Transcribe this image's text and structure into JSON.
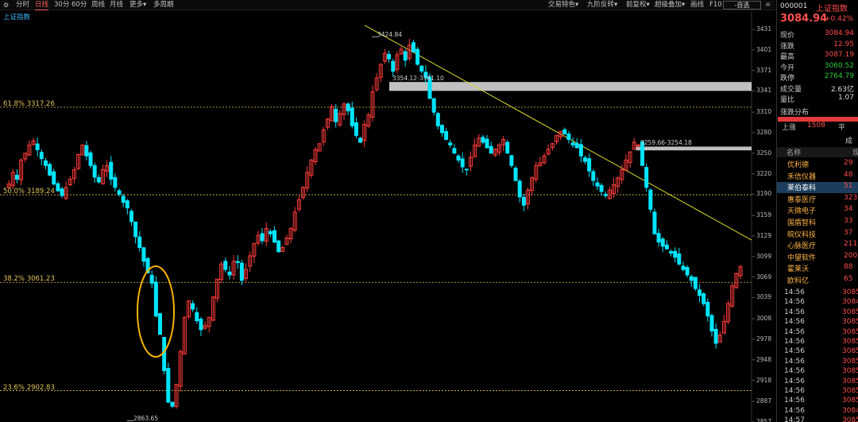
{
  "toolbar": {
    "periods": [
      "分时",
      "日线",
      "30分",
      "60分",
      "周线",
      "月线"
    ],
    "active_period": "日线",
    "more": "更多",
    "multi_period": "多周期",
    "right_items": [
      "交易特色",
      "九阶反转",
      "前复权",
      "超级叠加",
      "画线",
      "F10"
    ],
    "self_select": "-自选"
  },
  "chart": {
    "index_label": "上证指数",
    "y_ticks": [
      "3431",
      "3401",
      "3371",
      "3341",
      "3310",
      "3280",
      "3250",
      "3220",
      "3190",
      "3159",
      "3129",
      "3099",
      "3069",
      "3039",
      "3008",
      "2978",
      "2948",
      "2918",
      "2887",
      "2857"
    ],
    "fib_levels": [
      {
        "label": "61.8% 3317.26",
        "value": 3317.26
      },
      {
        "label": "50.0% 3189.24",
        "value": 3189.24
      },
      {
        "label": "38.2% 3061.23",
        "value": 3061.23
      },
      {
        "label": "23.6% 2902.83",
        "value": 2902.83
      }
    ],
    "annotations": {
      "high": "3424.84",
      "low": "2863.65",
      "zone1": "3354.12-3341.10",
      "zone2": "3259.66-3254.18"
    },
    "colors": {
      "up": "#ff3b3b",
      "down": "#00e5ff",
      "fib": "#e0c45c",
      "trend": "#d8d830",
      "zone": "#c0c0c0",
      "ellipse": "#f5b400"
    }
  },
  "quote": {
    "code": "000001",
    "name": "上证指数",
    "price": "3084.94",
    "pct": "+0.42%",
    "rows": [
      {
        "k": "现价",
        "v": "3084.94",
        "c": "#ff4e4e"
      },
      {
        "k": "涨跌",
        "v": "12.95",
        "c": "#ff4e4e"
      },
      {
        "k": "最高",
        "v": "3087.19",
        "c": "#ff4e4e"
      },
      {
        "k": "今开",
        "v": "3060.52",
        "c": "#2ecc40"
      },
      {
        "k": "跌停",
        "v": "2764.79",
        "c": "#2ecc40"
      },
      {
        "k": "成交量",
        "v": "2.63亿",
        "c": "#dddddd"
      },
      {
        "k": "量比",
        "v": "1.07",
        "c": "#dddddd"
      }
    ],
    "dist_title": "涨跌分布",
    "up_label": "上涨",
    "up_count": "1508",
    "flat_label": "平",
    "constituents_title": "成分",
    "name_header": "名称",
    "name_header2": "现",
    "constituents": [
      {
        "n": "优利德",
        "p": "29"
      },
      {
        "n": "禾信仪器",
        "p": "48"
      },
      {
        "n": "莱伯泰科",
        "p": "51"
      },
      {
        "n": "惠泰医疗",
        "p": "323"
      },
      {
        "n": "天微电子",
        "p": "34"
      },
      {
        "n": "国盾智科",
        "p": "33"
      },
      {
        "n": "皖仪科技",
        "p": "37"
      },
      {
        "n": "心脉医疗",
        "p": "211"
      },
      {
        "n": "中望软件",
        "p": "200"
      },
      {
        "n": "霍莱沃",
        "p": "88"
      },
      {
        "n": "欧科亿",
        "p": "65"
      }
    ],
    "ticks": [
      {
        "t": "14:56",
        "p": "3085"
      },
      {
        "t": "14:56",
        "p": "3084"
      },
      {
        "t": "14:56",
        "p": "3085"
      },
      {
        "t": "14:56",
        "p": "3085"
      },
      {
        "t": "14:56",
        "p": "3085"
      },
      {
        "t": "14:56",
        "p": "3085"
      },
      {
        "t": "14:56",
        "p": "3085"
      },
      {
        "t": "14:56",
        "p": "3085"
      },
      {
        "t": "14:56",
        "p": "3085"
      },
      {
        "t": "14:56",
        "p": "3085"
      },
      {
        "t": "14:56",
        "p": "3085"
      },
      {
        "t": "14:56",
        "p": "3085"
      },
      {
        "t": "14:56",
        "p": "3084"
      },
      {
        "t": "14:57",
        "p": "3085"
      }
    ]
  },
  "chart_data": {
    "type": "candlestick",
    "ylim": [
      2857,
      3431
    ],
    "high_label": 3424.84,
    "low_label": 2863.65
  }
}
